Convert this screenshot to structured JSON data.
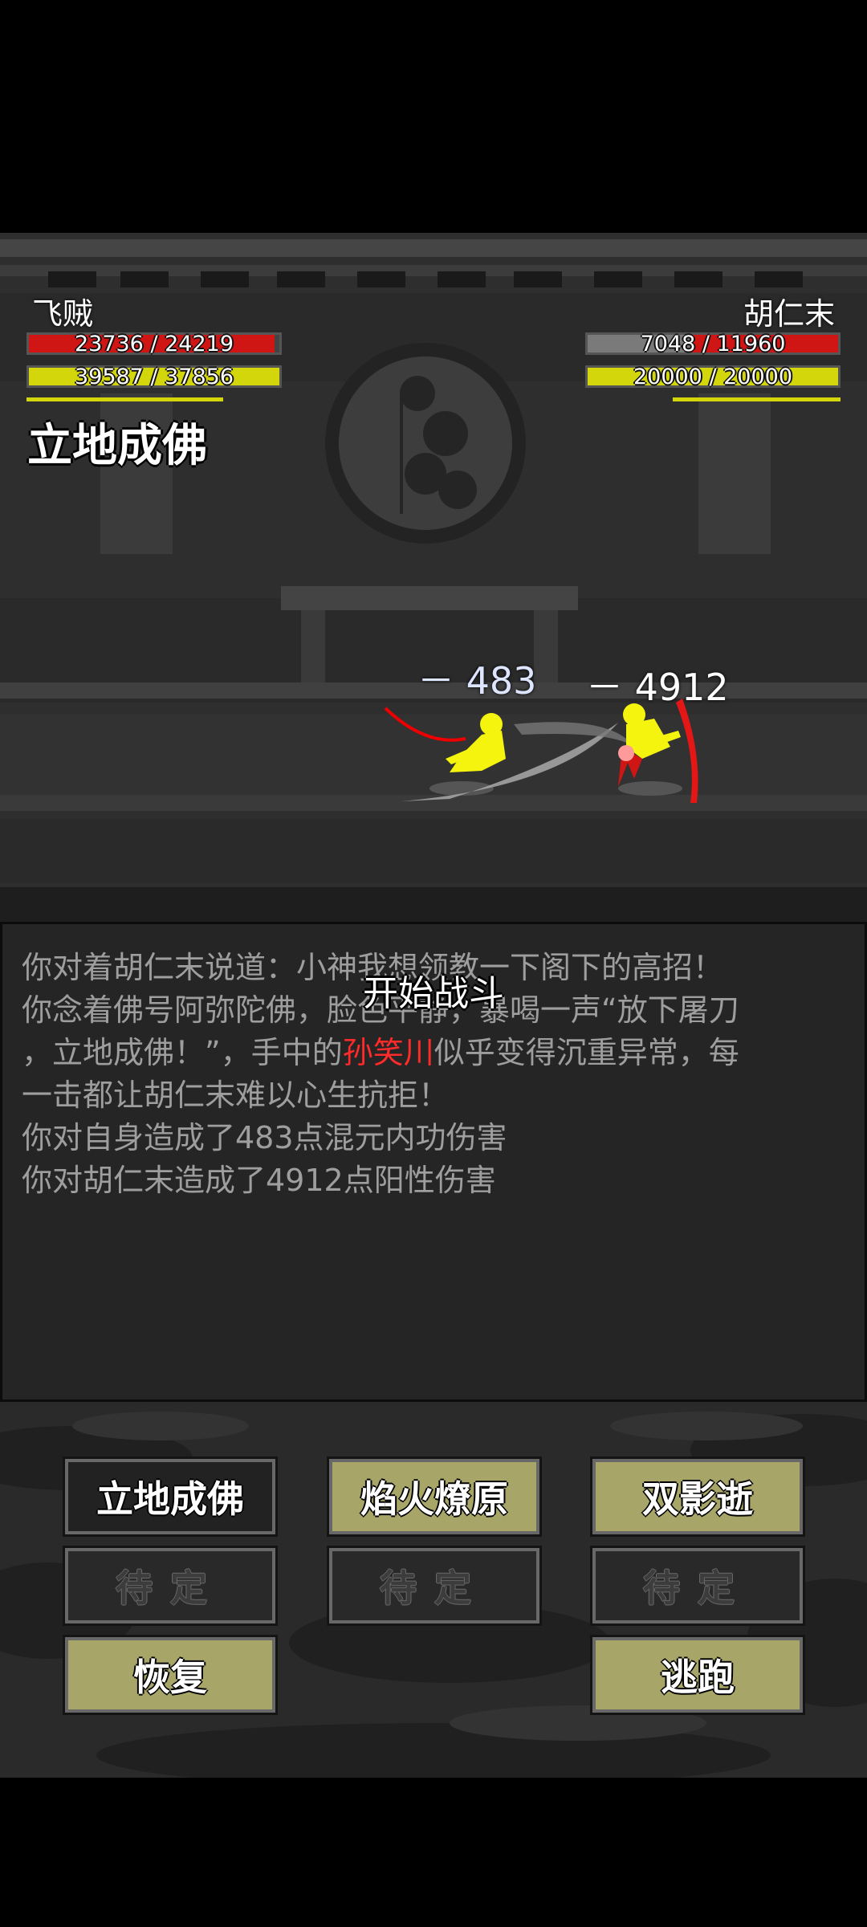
{
  "player": {
    "name": "飞贼",
    "hp": {
      "current": 23736,
      "max": 24219,
      "text": "23736 / 24219"
    },
    "mp": {
      "current": 39587,
      "max": 37856,
      "text": "39587 / 37856"
    },
    "active_skill": "立地成佛",
    "damage_taken": "－ 483"
  },
  "enemy": {
    "name": "胡仁末",
    "hp": {
      "current": 7048,
      "max": 11960,
      "text": "7048 / 11960"
    },
    "mp": {
      "current": 20000,
      "max": 20000,
      "text": "20000 / 20000"
    },
    "damage_taken": "－ 4912"
  },
  "battle_banner": "开始战斗",
  "log": {
    "lines": [
      {
        "text": "你对着胡仁末说道：小神我想领教一下阁下的高招！"
      },
      {
        "text": "你念着佛号阿弥陀佛，脸色平静，暴喝一声“放下屠刀"
      },
      {
        "pre": "，立地成佛！”，手中的",
        "highlight": "孙笑川",
        "post": "似乎变得沉重异常，每"
      },
      {
        "text": "一击都让胡仁末难以心生抗拒！"
      },
      {
        "text": "你对自身造成了483点混元内功伤害"
      },
      {
        "text": "你对胡仁末造成了4912点阳性伤害"
      }
    ]
  },
  "actions": {
    "skill_1": "立地成佛",
    "skill_2": "焰火燎原",
    "skill_3": "双影逝",
    "pending_1": "待定",
    "pending_2": "待定",
    "pending_3": "待定",
    "recover": "恢复",
    "flee": "逃跑"
  },
  "colors": {
    "hp_fill": "#d01515",
    "hp_empty": "#7a7a7a",
    "mp_fill": "#d4d60c",
    "button_olive": "#a8a568",
    "button_dark": "#222222",
    "log_text": "#9e9e9e",
    "log_highlight": "#ff2b2b"
  }
}
